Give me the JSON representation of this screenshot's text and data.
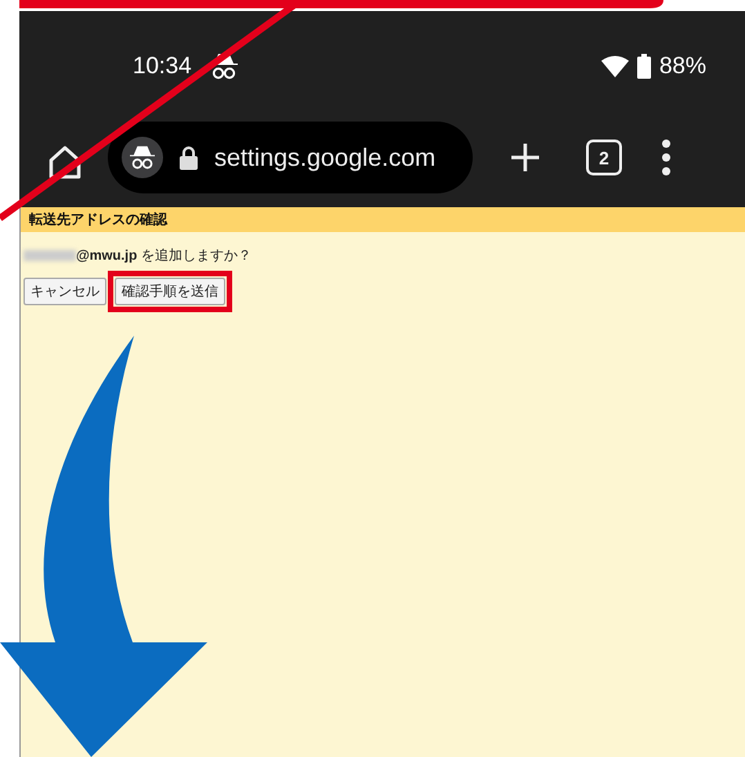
{
  "status_bar": {
    "time": "10:34",
    "battery": "88%"
  },
  "browser_toolbar": {
    "url": "settings.google.com",
    "tab_count": "2"
  },
  "page": {
    "title": "転送先アドレスの確認",
    "message": "**@mwu.jp** を追加しますか？",
    "buttons": [
      {
        "label": "キャンセル",
        "highlighted": false
      },
      {
        "label": "確認手順を送信",
        "highlighted": true
      }
    ]
  }
}
